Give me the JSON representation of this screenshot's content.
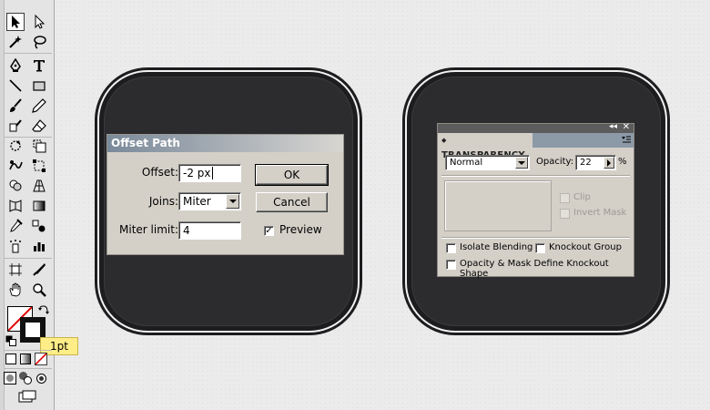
{
  "toolbar": {
    "tools": [
      "selection-tool",
      "direct-selection-tool",
      "magic-wand-tool",
      "lasso-tool",
      "pen-tool",
      "type-tool",
      "line-segment-tool",
      "rectangle-tool",
      "paintbrush-tool",
      "pencil-tool",
      "blob-brush-tool",
      "eraser-tool",
      "rotate-tool",
      "scale-tool",
      "warp-tool",
      "free-transform-tool",
      "shape-builder-tool",
      "perspective-grid-tool",
      "mesh-tool",
      "gradient-tool",
      "eyedropper-tool",
      "blend-tool",
      "symbol-sprayer-tool",
      "column-graph-tool",
      "artboard-tool",
      "slice-tool",
      "hand-tool",
      "zoom-tool"
    ],
    "tooltip": "1pt"
  },
  "offset_dialog": {
    "title": "Offset Path",
    "offset_label": "Offset:",
    "offset_value": "-2 px",
    "joins_label": "Joins:",
    "joins_value": "Miter",
    "miter_label": "Miter limit:",
    "miter_value": "4",
    "ok_label": "OK",
    "cancel_label": "Cancel",
    "preview_label": "Preview",
    "preview_checked": true
  },
  "transparency": {
    "tab_label": "TRANSPARENCY",
    "blend_mode": "Normal",
    "opacity_label": "Opacity:",
    "opacity_value": "22",
    "opacity_unit": "%",
    "clip_label": "Clip",
    "invert_mask_label": "Invert Mask",
    "isolate_label": "Isolate Blending",
    "knockout_label": "Knockout Group",
    "opacity_mask_label": "Opacity & Mask Define Knockout Shape"
  }
}
